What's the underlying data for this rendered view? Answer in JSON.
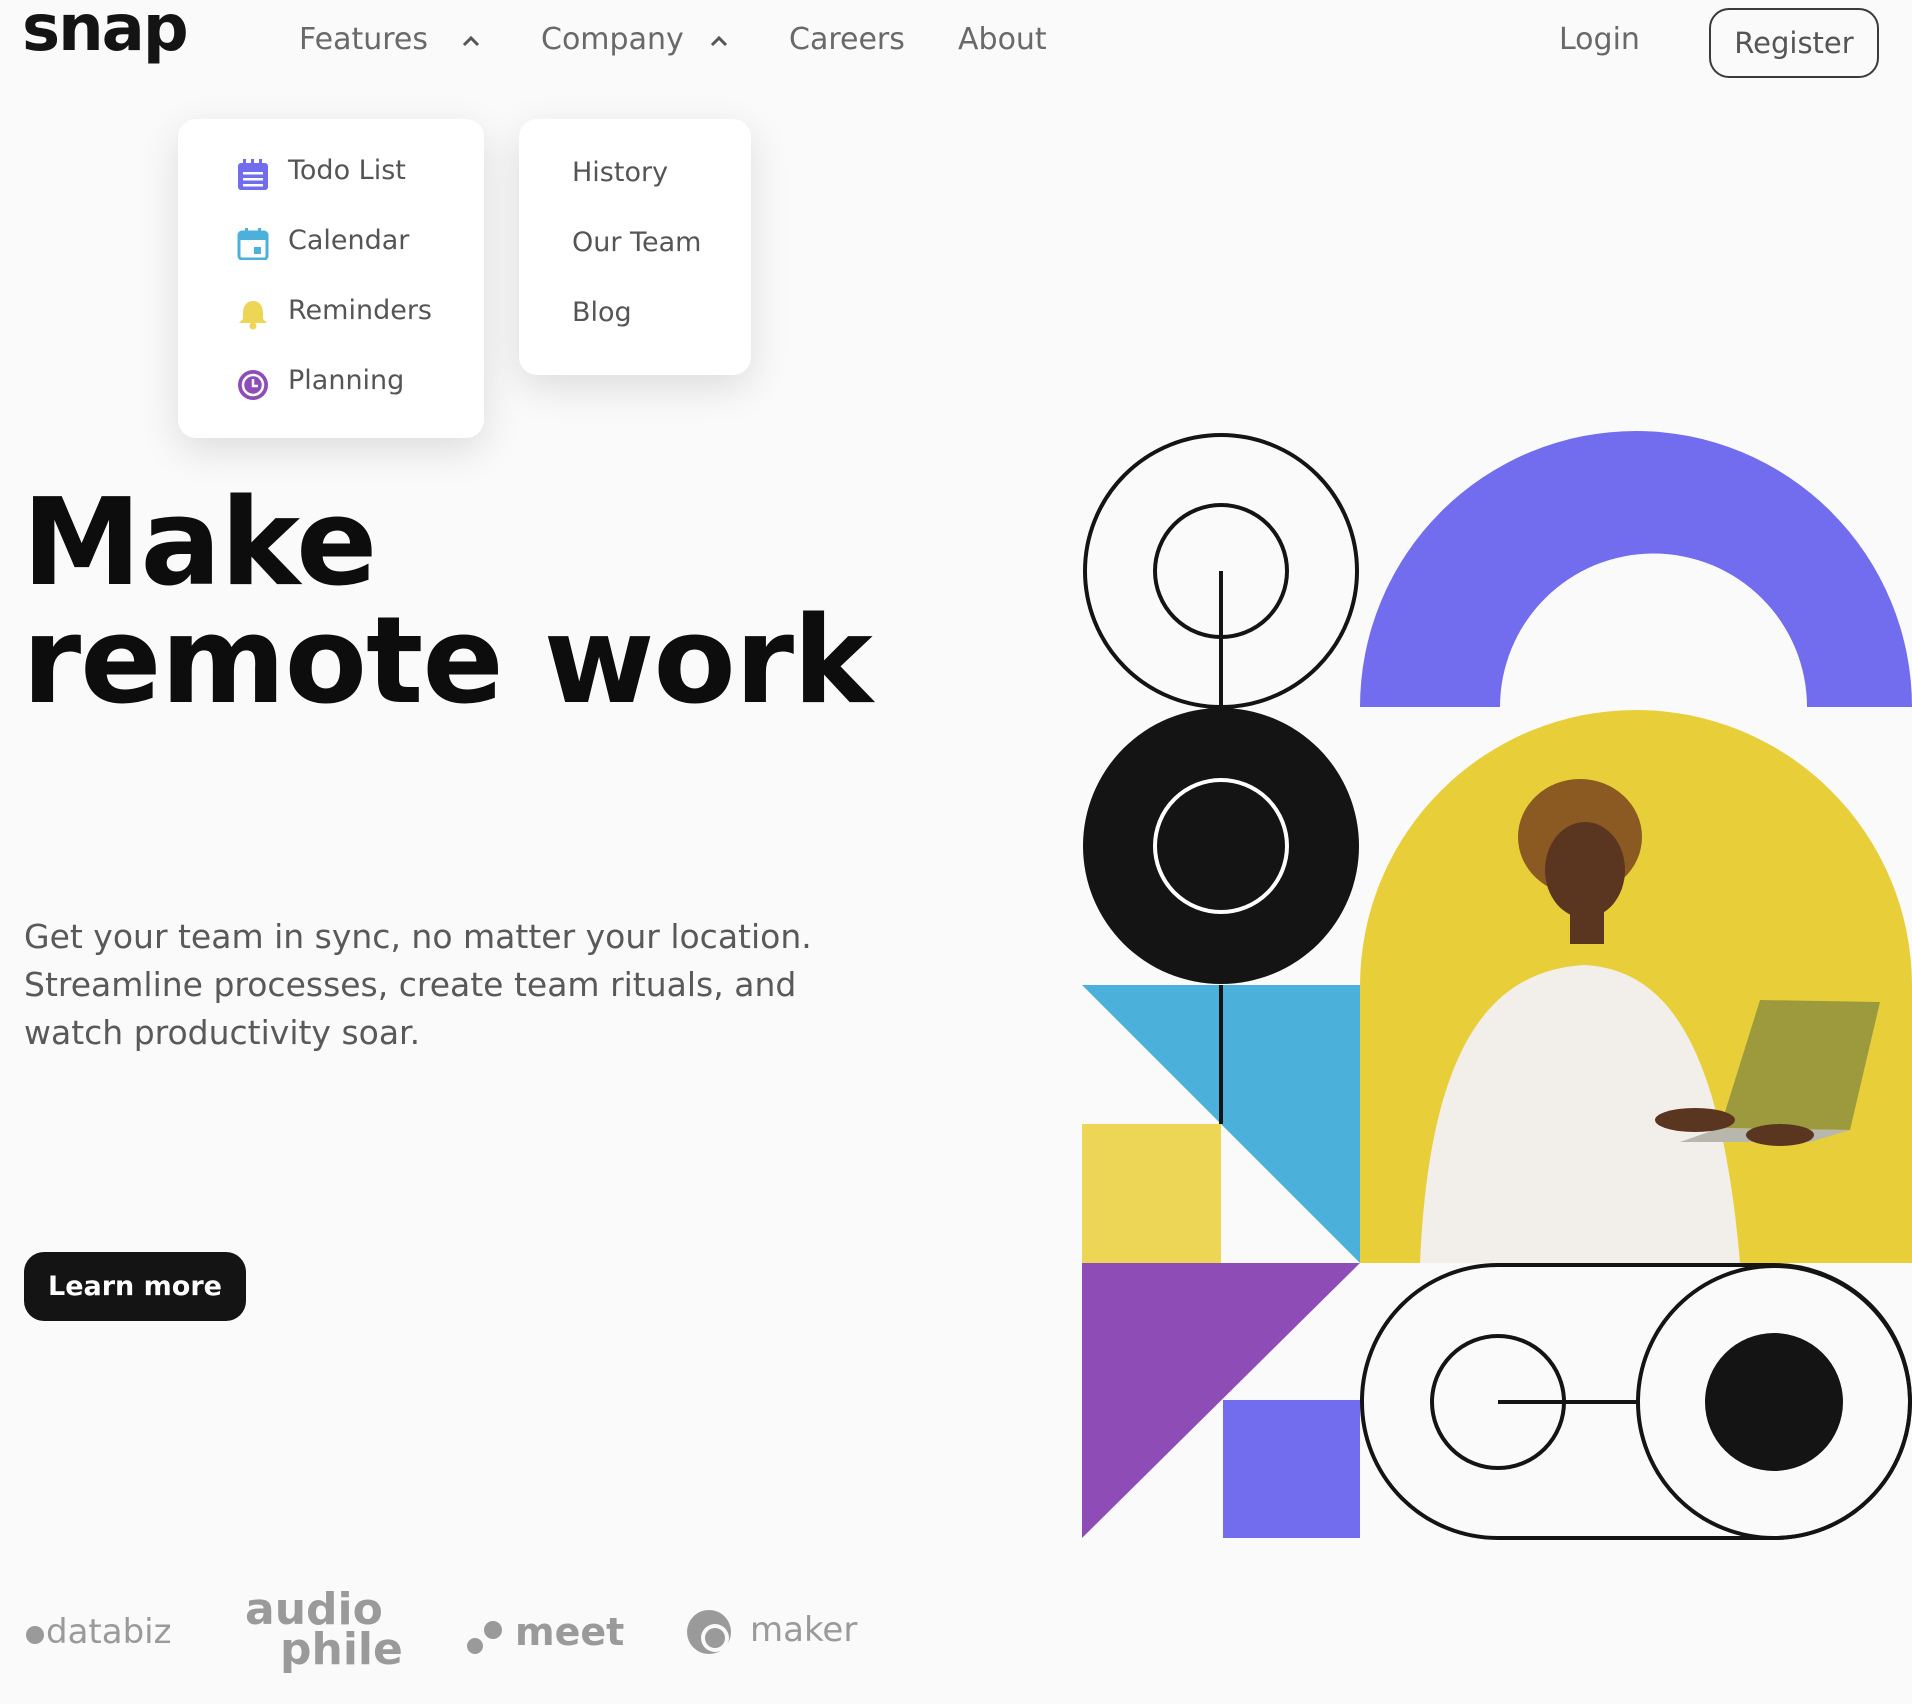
{
  "brand": {
    "logo": "snap"
  },
  "nav": {
    "features": "Features",
    "company": "Company",
    "careers": "Careers",
    "about": "About",
    "login": "Login",
    "register": "Register"
  },
  "features_menu": {
    "items": [
      {
        "label": "Todo List",
        "icon": "todo-icon",
        "color": "#726CEE"
      },
      {
        "label": "Calendar",
        "icon": "calendar-icon",
        "color": "#4BB1DA"
      },
      {
        "label": "Reminders",
        "icon": "bell-icon",
        "color": "#EDD556"
      },
      {
        "label": "Planning",
        "icon": "clock-icon",
        "color": "#8E4CB6"
      }
    ]
  },
  "company_menu": {
    "items": [
      {
        "label": "History"
      },
      {
        "label": "Our Team"
      },
      {
        "label": "Blog"
      }
    ]
  },
  "hero": {
    "title_line1": "Make",
    "title_line2": "remote work",
    "description": "Get your team in sync, no matter your location. Streamline processes, create team rituals, and watch productivity soar.",
    "cta": "Learn more"
  },
  "clients": {
    "databiz": "databiz",
    "audiophile_top": "audio",
    "audiophile_bottom": "phile",
    "meet": "meet",
    "maker": "maker"
  },
  "colors": {
    "purple": "#726CEE",
    "blue": "#4BB1DA",
    "yellow": "#EDD556",
    "violet": "#8E4CB6",
    "dark": "#141414"
  }
}
